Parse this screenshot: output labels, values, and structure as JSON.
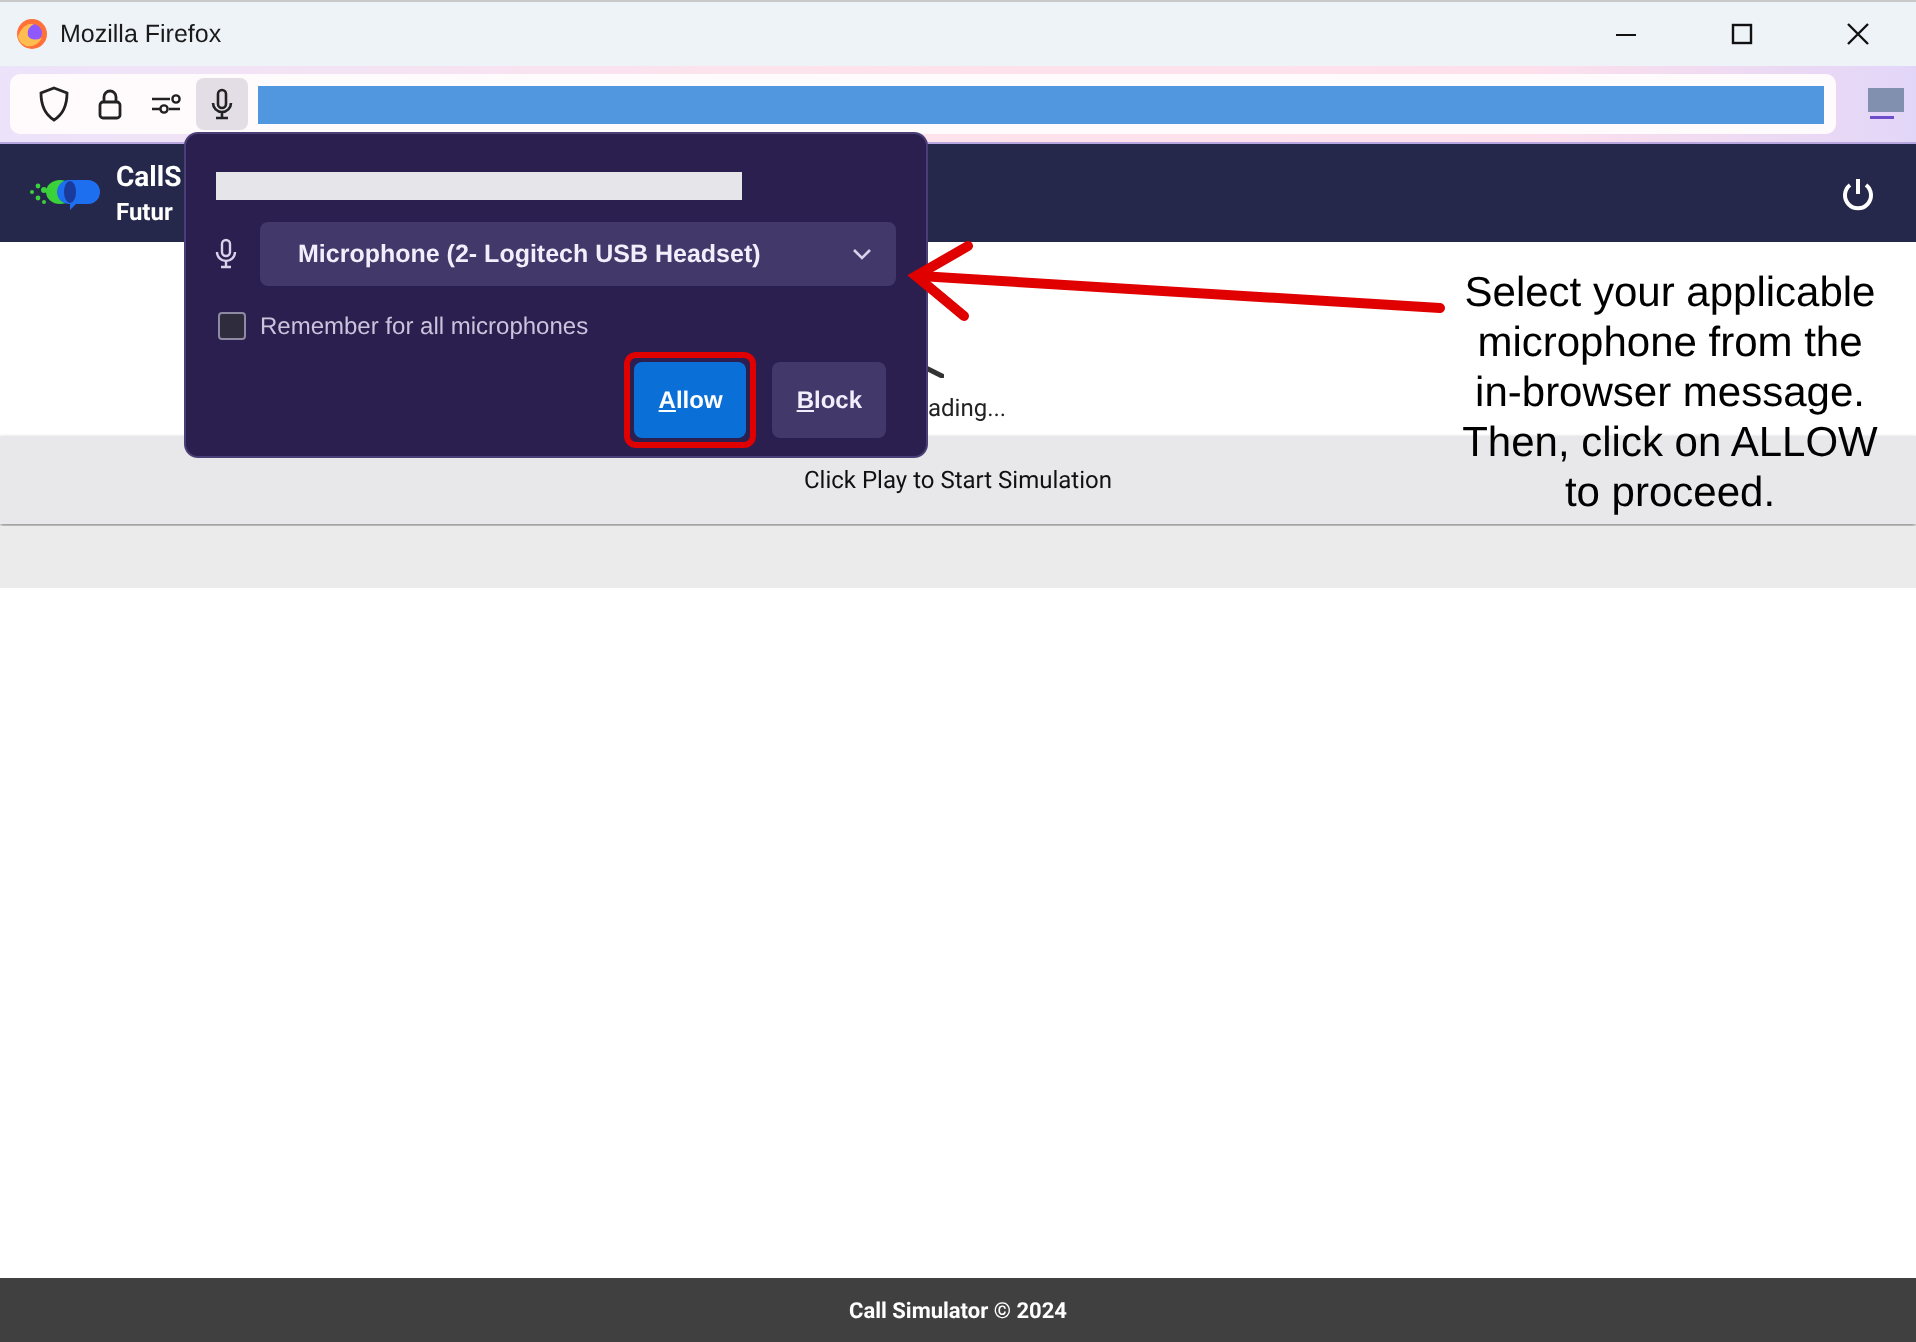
{
  "window": {
    "title": "Mozilla Firefox"
  },
  "app": {
    "title": "CallS",
    "subtitle": "Futur",
    "loading": "ading...",
    "status": "Click Play to Start Simulation",
    "footer": "Call Simulator © 2024"
  },
  "popup": {
    "device": "Microphone (2- Logitech USB Headset)",
    "remember": {
      "label": "Remember for all microphones",
      "checked": false
    },
    "buttons": [
      {
        "label": "Allow",
        "kind": "primary",
        "highlighted": true
      },
      {
        "label": "Block",
        "kind": "secondary",
        "highlighted": false
      }
    ]
  },
  "annotation": {
    "text": "Select your applicable microphone from the in-browser message. Then, click on ALLOW to proceed."
  }
}
